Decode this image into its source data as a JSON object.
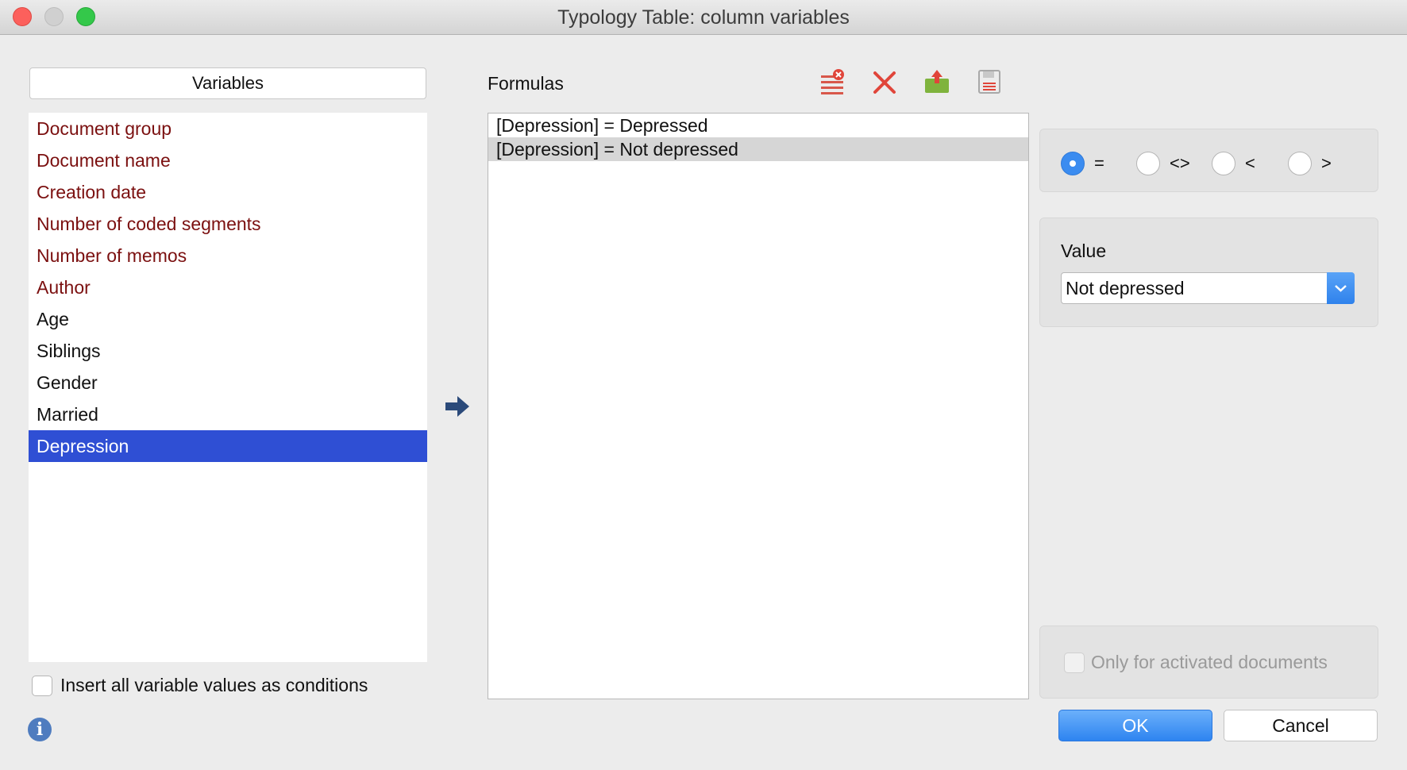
{
  "window": {
    "title": "Typology Table: column variables"
  },
  "variables": {
    "header": "Variables",
    "items": [
      {
        "label": "Document group",
        "kind": "system"
      },
      {
        "label": "Document name",
        "kind": "system"
      },
      {
        "label": "Creation date",
        "kind": "system"
      },
      {
        "label": "Number of coded segments",
        "kind": "system"
      },
      {
        "label": "Number of memos",
        "kind": "system"
      },
      {
        "label": "Author",
        "kind": "system"
      },
      {
        "label": "Age",
        "kind": "user"
      },
      {
        "label": "Siblings",
        "kind": "user"
      },
      {
        "label": "Gender",
        "kind": "user"
      },
      {
        "label": "Married",
        "kind": "user"
      },
      {
        "label": "Depression",
        "kind": "user",
        "selected": true
      }
    ],
    "insert_all_label": "Insert all variable values as conditions",
    "insert_all_checked": false
  },
  "formulas": {
    "label": "Formulas",
    "toolbar": [
      "clear-list-icon",
      "delete-icon",
      "export-icon",
      "save-icon"
    ],
    "items": [
      {
        "text": "[Depression] = Depressed"
      },
      {
        "text": "[Depression] = Not depressed",
        "selected": true
      }
    ]
  },
  "operators": {
    "options": [
      "=",
      "<>",
      "<",
      ">"
    ],
    "selected": "="
  },
  "value": {
    "label": "Value",
    "selected": "Not depressed"
  },
  "only_activated": {
    "label": "Only for activated documents",
    "checked": false,
    "enabled": false
  },
  "buttons": {
    "ok": "OK",
    "cancel": "Cancel"
  },
  "colors": {
    "system_variable": "#7b1010",
    "selection": "#2f4fd4",
    "accent": "#3b8cf0"
  }
}
